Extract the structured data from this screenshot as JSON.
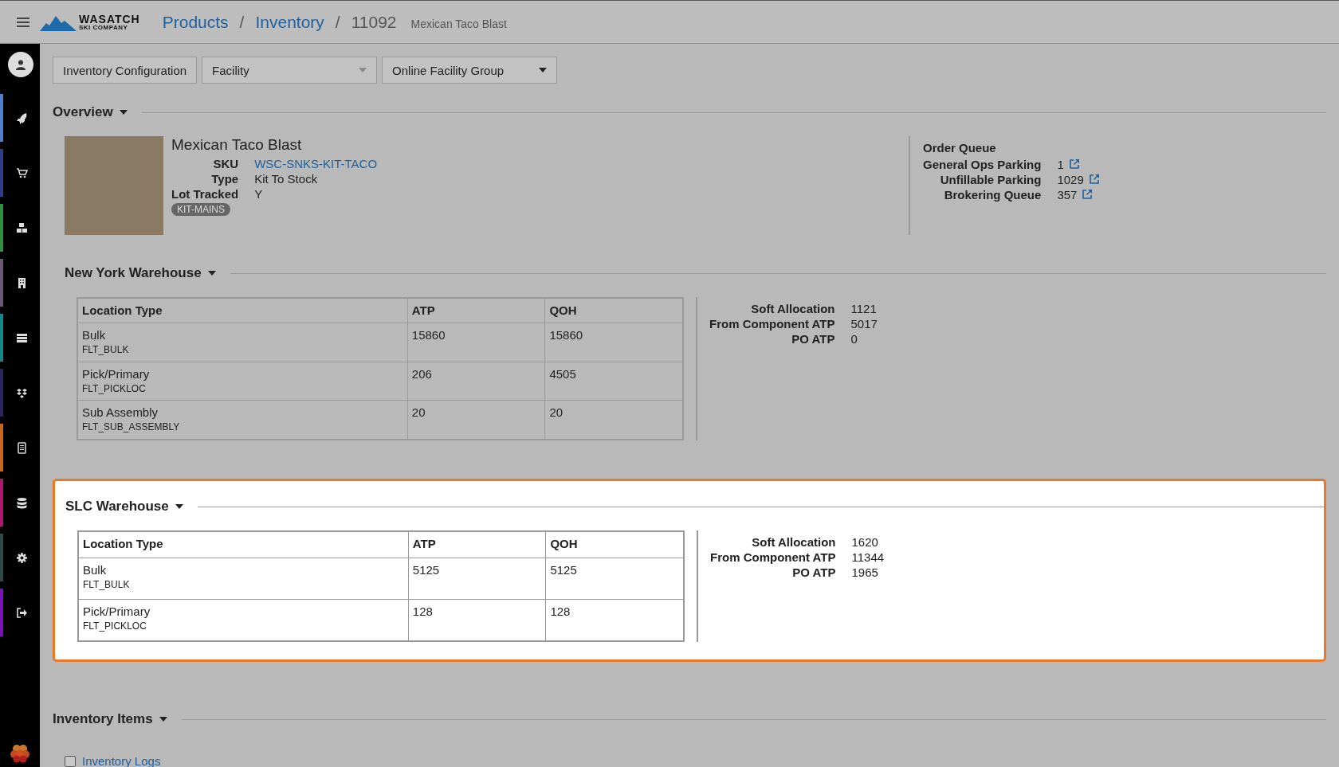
{
  "header": {
    "logo_line1": "WASATCH",
    "logo_line2": "SKI COMPANY",
    "breadcrumbs": [
      {
        "label": "Products",
        "link": true
      },
      {
        "separator": "/",
        "label": "Inventory",
        "link": true
      },
      {
        "separator": "/",
        "label": "11092",
        "link": false
      }
    ],
    "subtitle": "Mexican Taco Blast"
  },
  "sidebar": {
    "items": [
      {
        "color": "#4f7fd0"
      },
      {
        "color": "#2f3d8c"
      },
      {
        "color": "#2f8f3a"
      },
      {
        "color": "#6b5876"
      },
      {
        "color": "#128a8a"
      },
      {
        "color": "#2b275e"
      },
      {
        "color": "#c8661a"
      },
      {
        "color": "#b0166e"
      },
      {
        "color": "#2d4a48"
      },
      {
        "color": "#7a12b8"
      }
    ]
  },
  "toolbar": [
    {
      "kind": "button",
      "label": "Inventory Configuration"
    },
    {
      "kind": "select",
      "label": "Facility",
      "disabled": true
    },
    {
      "kind": "select",
      "label": "Online Facility Group",
      "disabled": false
    }
  ],
  "overview": {
    "title": "Overview",
    "product_name": "Mexican Taco Blast",
    "fields": [
      {
        "label": "SKU",
        "value": "WSC-SNKS-KIT-TACO",
        "link": true
      },
      {
        "label": "Type",
        "value": "Kit To Stock",
        "link": false
      },
      {
        "label": "Lot Tracked",
        "value": "Y",
        "link": false
      }
    ],
    "tag": "KIT-MAINS",
    "order_queue": {
      "title": "Order Queue",
      "rows": [
        {
          "label": "General Ops Parking",
          "value": "1"
        },
        {
          "label": "Unfillable Parking",
          "value": "1029"
        },
        {
          "label": "Brokering Queue",
          "value": "357"
        }
      ]
    }
  },
  "warehouses": [
    {
      "title": "New York Warehouse",
      "highlighted": false,
      "columns": [
        "Location Type",
        "ATP",
        "QOH"
      ],
      "rows": [
        {
          "name": "Bulk",
          "code": "FLT_BULK",
          "atp": "15860",
          "qoh": "15860"
        },
        {
          "name": "Pick/Primary",
          "code": "FLT_PICKLOC",
          "atp": "206",
          "qoh": "4505"
        },
        {
          "name": "Sub Assembly",
          "code": "FLT_SUB_ASSEMBLY",
          "atp": "20",
          "qoh": "20"
        }
      ],
      "stats": [
        {
          "label": "Soft Allocation",
          "value": "1121"
        },
        {
          "label": "From Component ATP",
          "value": "5017"
        },
        {
          "label": "PO ATP",
          "value": "0"
        }
      ]
    },
    {
      "title": "SLC Warehouse",
      "highlighted": true,
      "columns": [
        "Location Type",
        "ATP",
        "QOH"
      ],
      "rows": [
        {
          "name": "Bulk",
          "code": "FLT_BULK",
          "atp": "5125",
          "qoh": "5125"
        },
        {
          "name": "Pick/Primary",
          "code": "FLT_PICKLOC",
          "atp": "128",
          "qoh": "128"
        }
      ],
      "stats": [
        {
          "label": "Soft Allocation",
          "value": "1620"
        },
        {
          "label": "From Component ATP",
          "value": "11344"
        },
        {
          "label": "PO ATP",
          "value": "1965"
        }
      ]
    }
  ],
  "inventory_items": {
    "title": "Inventory Items",
    "logs": {
      "label": "Inventory Logs",
      "checked": false
    }
  }
}
